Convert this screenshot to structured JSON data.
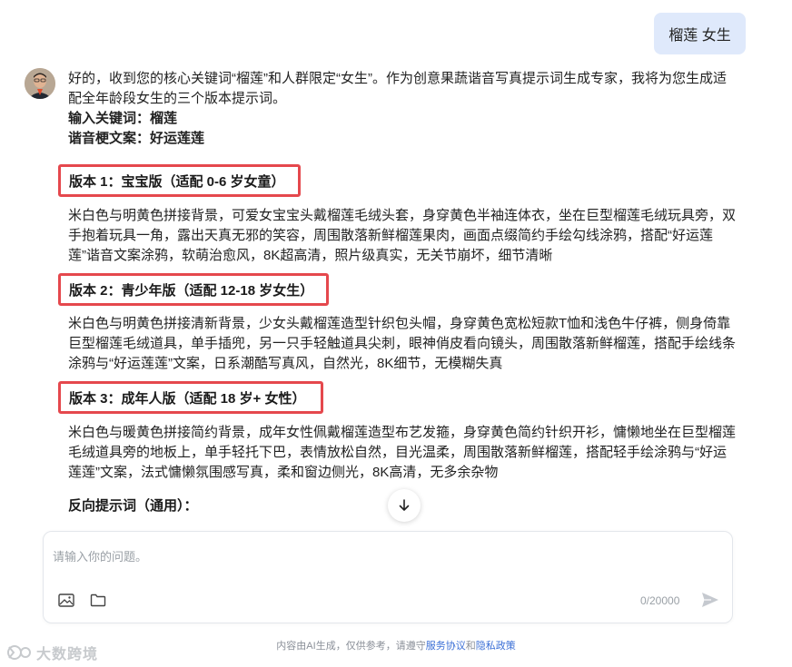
{
  "user_message": "榴莲 女生",
  "assistant": {
    "intro": "好的，收到您的核心关键词“榴莲”和人群限定“女生”。作为创意果蔬谐音写真提示词生成专家，我将为您生成适配全年龄段女生的三个版本提示词。",
    "keyword_label": "输入关键词：榴莲",
    "pun_label": "谐音梗文案：好运莲莲",
    "versions": [
      {
        "title": "版本 1：宝宝版（适配 0-6 岁女童）",
        "description": "米白色与明黄色拼接背景，可爱女宝宝头戴榴莲毛绒头套，身穿黄色半袖连体衣，坐在巨型榴莲毛绒玩具旁，双手抱着玩具一角，露出天真无邪的笑容，周围散落新鲜榴莲果肉，画面点缀简约手绘勾线涂鸦，搭配“好运莲莲”谐音文案涂鸦，软萌治愈风，8K超高清，照片级真实，无关节崩坏，细节清晰"
      },
      {
        "title": "版本 2：青少年版（适配 12-18 岁女生）",
        "description": "米白色与明黄色拼接清新背景，少女头戴榴莲造型针织包头帽，身穿黄色宽松短款T恤和浅色牛仔裤，侧身倚靠巨型榴莲毛绒道具，单手插兜，另一只手轻触道具尖刺，眼神俏皮看向镜头，周围散落新鲜榴莲，搭配手绘线条涂鸦与“好运莲莲”文案，日系潮酷写真风，自然光，8K细节，无模糊失真"
      },
      {
        "title": "版本 3：成年人版（适配 18 岁+ 女性）",
        "description": "米白色与暖黄色拼接简约背景，成年女性佩戴榴莲造型布艺发箍，身穿黄色简约针织开衫，慵懒地坐在巨型榴莲毛绒道具旁的地板上，单手轻托下巴，表情放松自然，目光温柔，周围散落新鲜榴莲，搭配轻手绘涂鸦与“好运莲莲”文案，法式慵懒氛围感写真，柔和窗边侧光，8K高清，无多余杂物"
      }
    ],
    "negative_label": "反向提示词（通用）："
  },
  "composer": {
    "placeholder": "请输入你的问题。",
    "value": "",
    "counter": "0/20000",
    "image_icon": "image-icon",
    "folder_icon": "folder-icon",
    "send_icon": "send-icon"
  },
  "footer": {
    "prefix": "内容由AI生成，仅供参考，请遵守",
    "service_link": "服务协议",
    "and": "和",
    "privacy_link": "隐私政策"
  },
  "logo_text": "大数跨境",
  "colors": {
    "user_bubble": "#dfe9fb",
    "highlight_border": "#e5484d",
    "link": "#3b6fd6",
    "muted": "#9aa0a6"
  }
}
